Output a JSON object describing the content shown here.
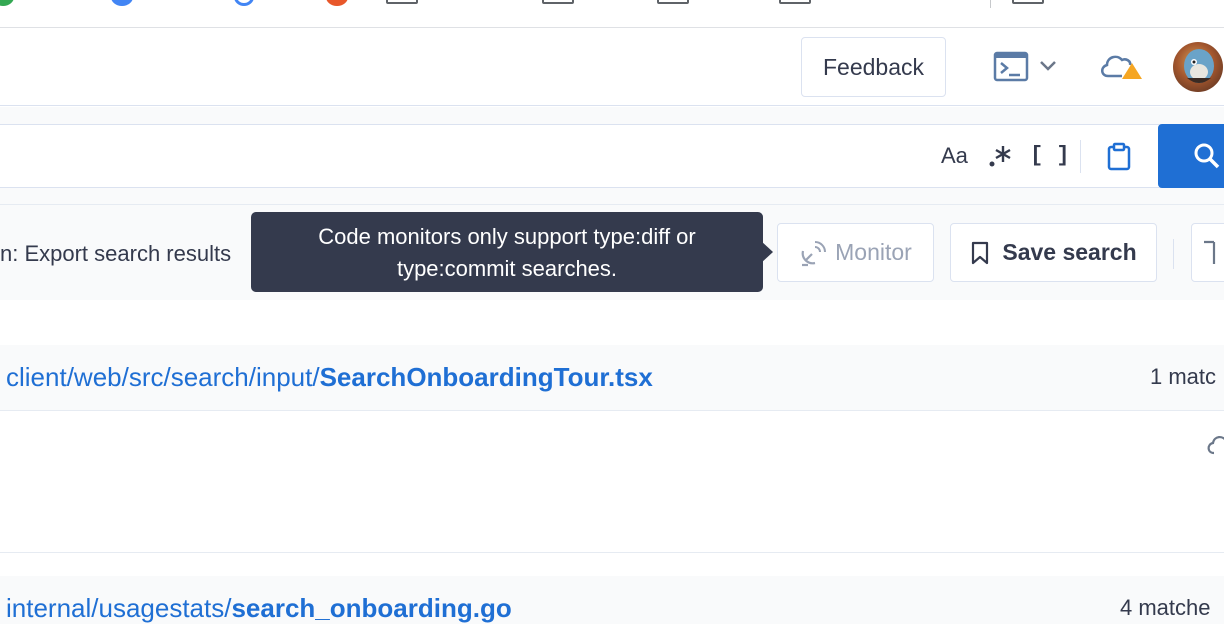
{
  "top_nav": {
    "feedback_label": "Feedback",
    "terminal_icon": "terminal-icon",
    "chevron_icon": "chevron-down-icon",
    "cloud_icon": "cloud-warning-icon"
  },
  "search_toggles": {
    "case_label": "Aa",
    "regex_label": ".*",
    "structural_label": "[ ]"
  },
  "toolbar": {
    "export_text": "n: Export search results",
    "monitor_label": "Monitor",
    "save_search_label": "Save search"
  },
  "tooltip": {
    "line1": "Code monitors only support type:diff or",
    "line2": "type:commit searches."
  },
  "results": [
    {
      "path_prefix": "client/web/src/search/input/",
      "file_name": "SearchOnboardingTour.tsx",
      "match_count": "1 matc"
    },
    {
      "path_prefix": "internal/usagestats/",
      "file_name": "search_onboarding.go",
      "match_count": "4 matche"
    }
  ],
  "colors": {
    "accent": "#1f6fd4",
    "tooltip_bg": "#343a4d",
    "warning": "#f5a623"
  }
}
